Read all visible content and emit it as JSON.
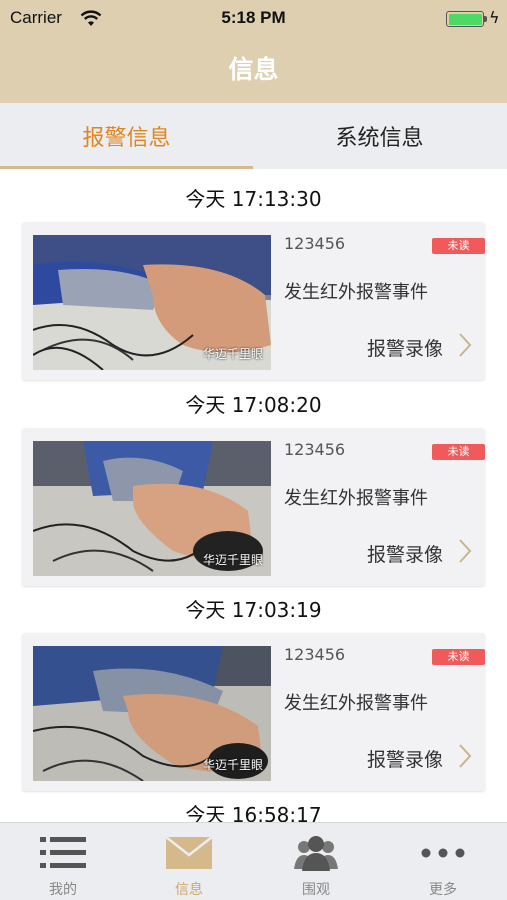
{
  "status_bar": {
    "carrier": "Carrier",
    "time": "5:18 PM"
  },
  "header": {
    "title": "信息"
  },
  "tabs": [
    {
      "label": "报警信息",
      "active": true
    },
    {
      "label": "系统信息",
      "active": false
    }
  ],
  "alarms": [
    {
      "timestamp": "今天 17:13:30",
      "device_id": "123456",
      "badge": "未读",
      "event": "发生红外报警事件",
      "video_link": "报警录像",
      "watermark": "华迈千里眼"
    },
    {
      "timestamp": "今天 17:08:20",
      "device_id": "123456",
      "badge": "未读",
      "event": "发生红外报警事件",
      "video_link": "报警录像",
      "watermark": "华迈千里眼"
    },
    {
      "timestamp": "今天 17:03:19",
      "device_id": "123456",
      "badge": "未读",
      "event": "发生红外报警事件",
      "video_link": "报警录像",
      "watermark": "华迈千里眼"
    },
    {
      "timestamp": "今天 16:58:17"
    }
  ],
  "bottom_nav": [
    {
      "label": "我的",
      "icon": "list-icon",
      "active": false
    },
    {
      "label": "信息",
      "icon": "envelope-icon",
      "active": true
    },
    {
      "label": "围观",
      "icon": "people-icon",
      "active": false
    },
    {
      "label": "更多",
      "icon": "more-dots-icon",
      "active": false
    }
  ],
  "colors": {
    "header_bg": "#ddcfb0",
    "accent": "#e0861d",
    "badge": "#f05a5a",
    "nav_active": "#caa96a"
  }
}
